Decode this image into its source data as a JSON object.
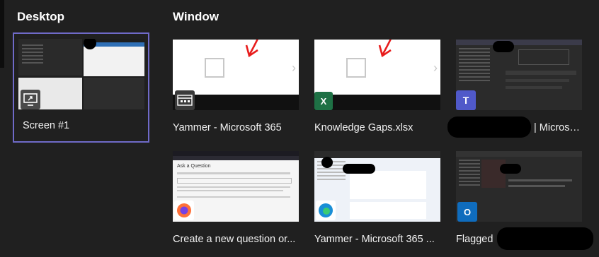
{
  "sections": {
    "desktop": "Desktop",
    "window": "Window"
  },
  "desktop_tiles": [
    {
      "label": "Screen #1",
      "icon": "monitor-share-icon",
      "selected": true
    }
  ],
  "window_tiles": [
    {
      "label": "Yammer - Microsoft 365",
      "icon": "yammer-app-icon"
    },
    {
      "label": "Knowledge Gaps.xlsx",
      "icon": "excel-icon"
    },
    {
      "label": "| Microso...",
      "icon": "teams-icon"
    },
    {
      "label": "Create a new question or...",
      "icon": "firefox-icon"
    },
    {
      "label": "Yammer - Microsoft 365 ...",
      "icon": "edge-icon"
    },
    {
      "label": "Flagged",
      "icon": "outlook-icon"
    }
  ],
  "thumb_texts": {
    "ask_question": "Ask a Question"
  },
  "colors": {
    "background": "#202020",
    "selection_border": "#6f6ac8",
    "annotation_arrow": "#e81c1c",
    "excel_green": "#1e7145",
    "teams_purple": "#5059c9",
    "outlook_blue": "#0f6cbd"
  }
}
